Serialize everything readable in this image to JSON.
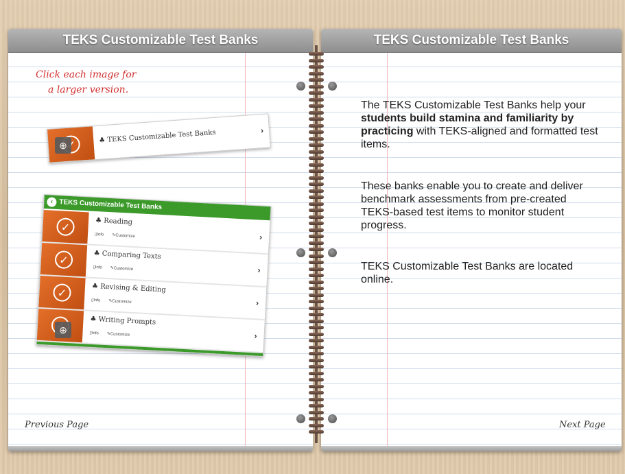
{
  "left_page": {
    "title": "TEKS Customizable Test Banks",
    "note_line1": "Click each image for",
    "note_line2": "a larger version.",
    "prev_label": "Previous Page",
    "shot1_label": "TEKS Customizable Test Banks",
    "shot2": {
      "header": "TEKS Customizable Test Banks",
      "rows": [
        {
          "title": "Reading",
          "info": "Info",
          "customize": "Customize"
        },
        {
          "title": "Comparing Texts",
          "info": "Info",
          "customize": "Customize"
        },
        {
          "title": "Revising & Editing",
          "info": "Info",
          "customize": "Customize"
        },
        {
          "title": "Writing Prompts",
          "info": "Info",
          "customize": "Customize"
        }
      ]
    }
  },
  "right_page": {
    "title": "TEKS Customizable Test Banks",
    "para1_pre": "The TEKS Customizable Test Banks help your ",
    "para1_bold": "students build stamina and familiarity by practicing",
    "para1_post": " with TEKS-aligned and formatted test items.",
    "para2": "These banks enable you to create and deliver benchmark assessments from pre-created TEKS-based test items to monitor student progress.",
    "para3": "TEKS Customizable Test Banks are located online.",
    "next_label": "Next Page"
  },
  "colors": {
    "accent_orange": "#d35a1a",
    "accent_green": "#3b9a2a",
    "note_red": "#d0302f"
  }
}
